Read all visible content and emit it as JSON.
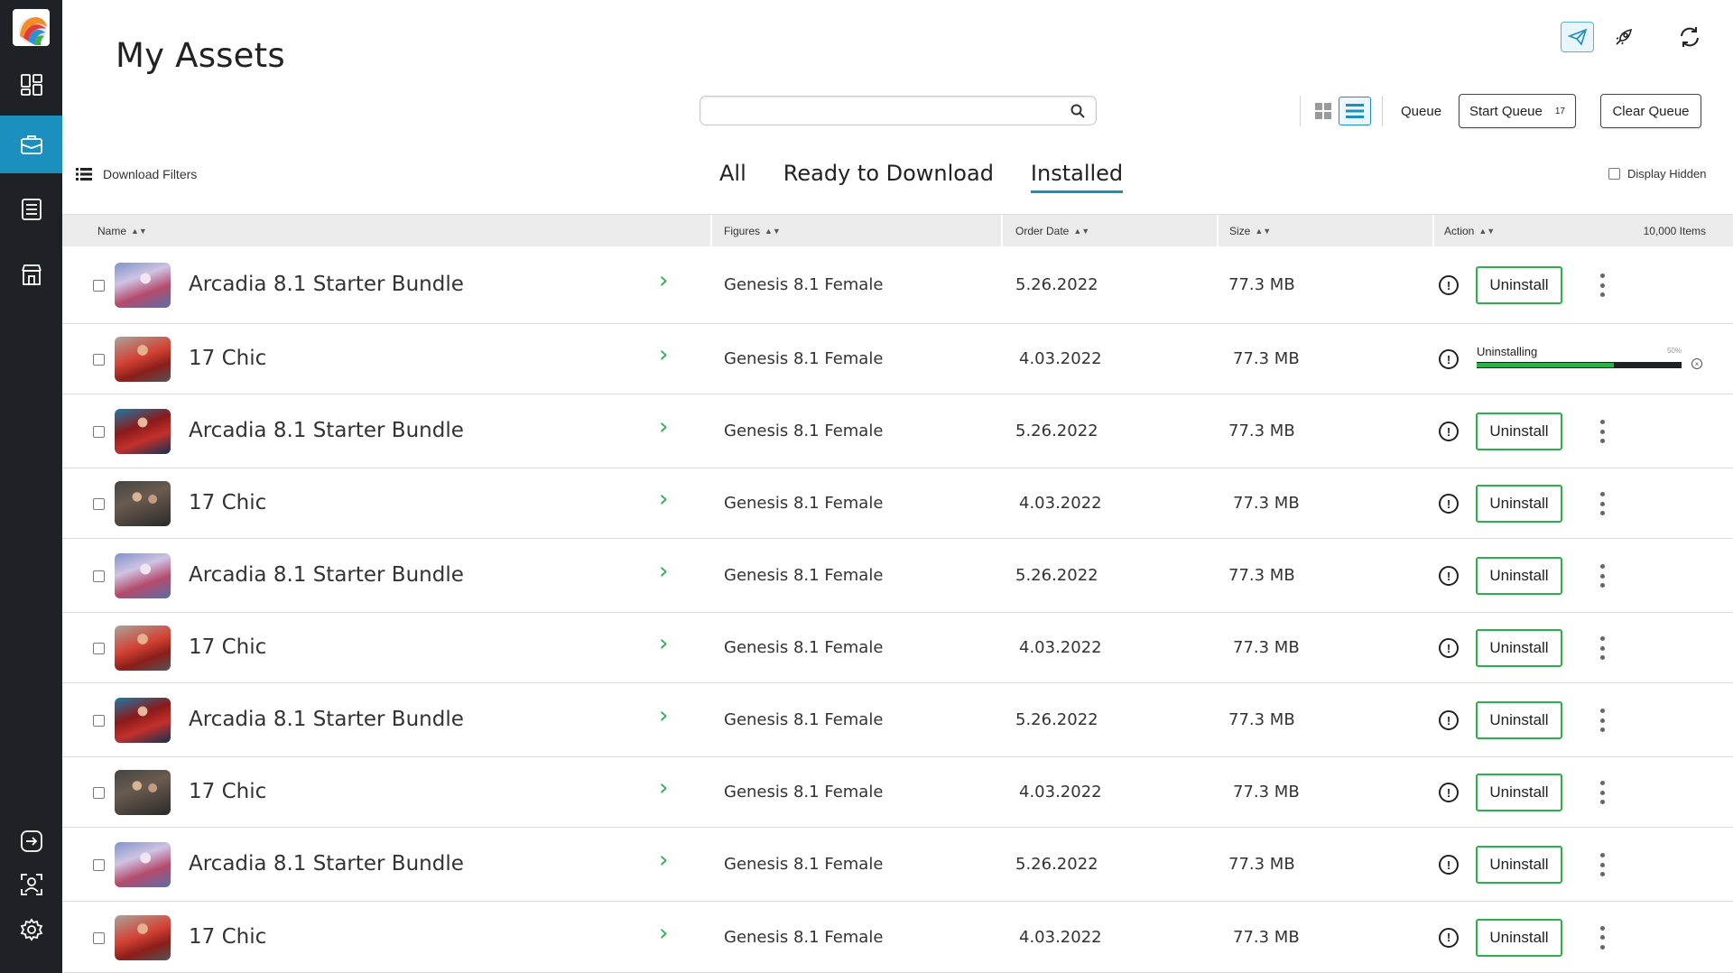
{
  "app": {
    "page_title": "My Assets"
  },
  "sidebar": {
    "items": [
      {
        "icon": "dashboard-icon",
        "active": false
      },
      {
        "icon": "briefcase-icon",
        "active": true
      },
      {
        "icon": "list-document-icon",
        "active": false
      },
      {
        "icon": "store-icon",
        "active": false
      }
    ],
    "bottom_items": [
      {
        "icon": "sign-out-icon"
      },
      {
        "icon": "user-profile-icon"
      },
      {
        "icon": "settings-gear-icon"
      }
    ]
  },
  "toolbar": {
    "search_value": "",
    "queue_label": "Queue",
    "start_queue_label": "Start Queue",
    "start_queue_count": "17",
    "clear_queue_label": "Clear Queue"
  },
  "filters": {
    "download_filters_label": "Download Filters",
    "display_hidden_label": "Display Hidden",
    "display_hidden_checked": false
  },
  "tabs": [
    {
      "label": "All",
      "active": false
    },
    {
      "label": "Ready to Download",
      "active": false
    },
    {
      "label": "Installed",
      "active": true
    }
  ],
  "table": {
    "columns": {
      "name": "Name",
      "figures": "Figures",
      "order_date": "Order Date",
      "size": "Size",
      "action": "Action"
    },
    "items_count": "10,000 Items",
    "rows": [
      {
        "name": "Arcadia 8.1 Starter Bundle",
        "figure": "Genesis 8.1 Female",
        "date": "5.26.2022",
        "size": "77.3 MB",
        "action": "Uninstall",
        "thumb": "a"
      },
      {
        "name": "17 Chic",
        "figure": "Genesis 8.1 Female",
        "date": "4.03.2022",
        "size": "77.3 MB",
        "action": "progress",
        "progress_label": "Uninstalling",
        "progress_pct": "50%",
        "progress_fraction": 0.67,
        "thumb": "b"
      },
      {
        "name": "Arcadia 8.1 Starter Bundle",
        "figure": "Genesis 8.1 Female",
        "date": "5.26.2022",
        "size": "77.3 MB",
        "action": "Uninstall",
        "thumb": "c"
      },
      {
        "name": "17 Chic",
        "figure": "Genesis 8.1 Female",
        "date": "4.03.2022",
        "size": "77.3 MB",
        "action": "Uninstall",
        "thumb": "d"
      },
      {
        "name": "Arcadia 8.1 Starter Bundle",
        "figure": "Genesis 8.1 Female",
        "date": "5.26.2022",
        "size": "77.3 MB",
        "action": "Uninstall",
        "thumb": "a"
      },
      {
        "name": "17 Chic",
        "figure": "Genesis 8.1 Female",
        "date": "4.03.2022",
        "size": "77.3 MB",
        "action": "Uninstall",
        "thumb": "b"
      },
      {
        "name": "Arcadia 8.1 Starter Bundle",
        "figure": "Genesis 8.1 Female",
        "date": "5.26.2022",
        "size": "77.3 MB",
        "action": "Uninstall",
        "thumb": "c"
      },
      {
        "name": "17 Chic",
        "figure": "Genesis 8.1 Female",
        "date": "4.03.2022",
        "size": "77.3 MB",
        "action": "Uninstall",
        "thumb": "d"
      },
      {
        "name": "Arcadia 8.1 Starter Bundle",
        "figure": "Genesis 8.1 Female",
        "date": "5.26.2022",
        "size": "77.3 MB",
        "action": "Uninstall",
        "thumb": "a"
      },
      {
        "name": "17 Chic",
        "figure": "Genesis 8.1 Female",
        "date": "4.03.2022",
        "size": "77.3 MB",
        "action": "Uninstall",
        "thumb": "b"
      }
    ]
  },
  "colors": {
    "sidebar_bg": "#1e2227",
    "accent_blue": "#1b8fbe",
    "accent_green": "#2bb04c"
  }
}
